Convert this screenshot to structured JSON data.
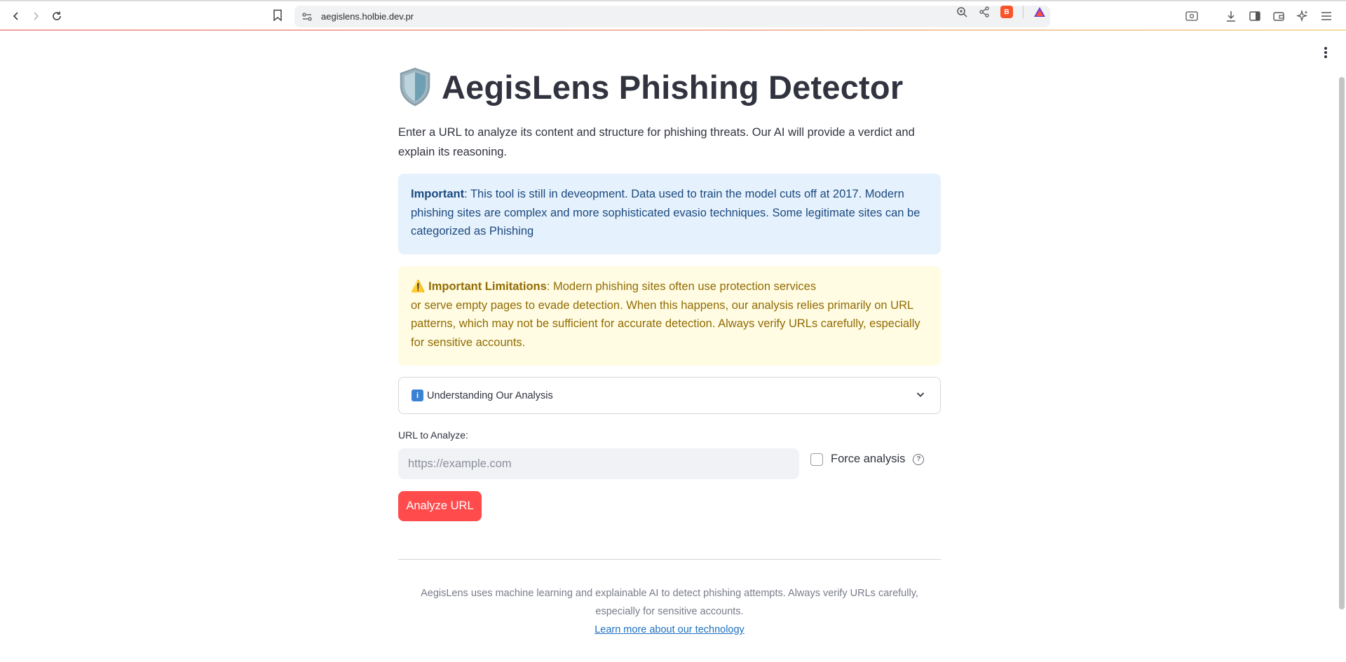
{
  "browser": {
    "url": "aegislens.holbie.dev.pr",
    "back_icon": "chevron-left-icon",
    "forward_icon": "chevron-right-icon",
    "reload_icon": "reload-icon"
  },
  "page": {
    "title": "AegisLens Phishing Detector",
    "intro": "Enter a URL to analyze its content and structure for phishing threats. Our AI will provide a verdict and explain its reasoning.",
    "info_box": {
      "bold": "Important",
      "text": ": This tool is still in deveopment. Data used to train the model cuts off at 2017. Modern phishing sites are complex and more sophisticated evasio techniques. Some legitimate sites can be categorized as Phishing"
    },
    "warning_box": {
      "emoji": "⚠️",
      "bold": "Important Limitations",
      "line1": ": Modern phishing sites often use protection services",
      "line2": "or serve empty pages to evade detection. When this happens, our analysis relies primarily on URL patterns, which may not be sufficient for accurate detection. Always verify URLs carefully, especially for sensitive accounts."
    },
    "expander": {
      "label": "Understanding Our Analysis"
    },
    "url_field": {
      "label": "URL to Analyze:",
      "placeholder": "https://example.com",
      "value": ""
    },
    "force_analysis": {
      "label": "Force analysis",
      "checked": false
    },
    "analyze_button": "Analyze URL",
    "footer": {
      "text": "AegisLens uses machine learning and explainable AI to detect phishing attempts. Always verify URLs carefully, especially for sensitive accounts.",
      "link": "Learn more about our technology"
    }
  },
  "colors": {
    "primary_button": "#ff4b4b",
    "info_bg": "#e5f1fc",
    "info_text": "#1c4a80",
    "warning_bg": "#fffce3",
    "warning_text": "#926c05",
    "link": "#1e70bf"
  }
}
